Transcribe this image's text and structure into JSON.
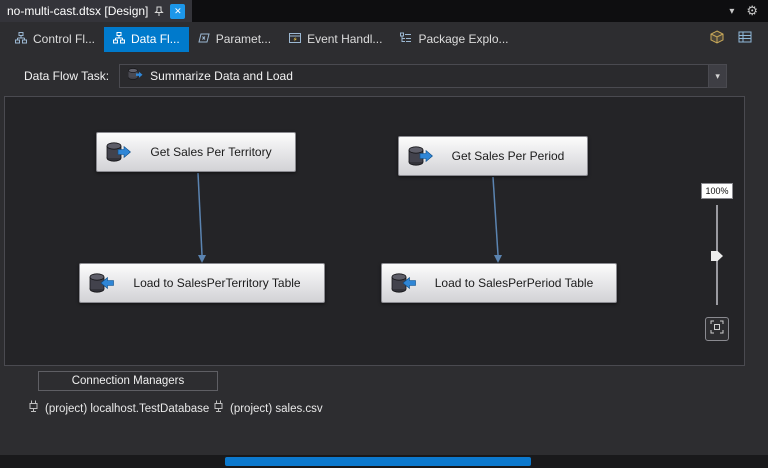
{
  "colors": {
    "accent": "#007acc",
    "connector": "#5b84b1",
    "scroll_thumb": "#0c79ce"
  },
  "glyphs": {
    "dropdown": "▾",
    "gear": "⚙",
    "close": "✕"
  },
  "title_bar": {
    "document_tab": "no-multi-cast.dtsx [Design]"
  },
  "design_tabs": {
    "active_index": 1,
    "items": [
      {
        "label": "Control Fl..."
      },
      {
        "label": "Data Fl..."
      },
      {
        "label": "Paramet..."
      },
      {
        "label": "Event Handl..."
      },
      {
        "label": "Package Explo..."
      }
    ]
  },
  "toolbar": {
    "task_label": "Data Flow Task:",
    "task_value": "Summarize Data and Load"
  },
  "canvas": {
    "zoom_level": "100%",
    "components": [
      {
        "label": "Get Sales Per Territory",
        "kind": "source"
      },
      {
        "label": "Get Sales Per Period",
        "kind": "source"
      },
      {
        "label": "Load to SalesPerTerritory Table",
        "kind": "destination"
      },
      {
        "label": "Load to SalesPerPeriod Table",
        "kind": "destination"
      }
    ],
    "connections": [
      {
        "from": "Get Sales Per Territory",
        "to": "Load to SalesPerTerritory Table"
      },
      {
        "from": "Get Sales Per Period",
        "to": "Load to SalesPerPeriod Table"
      }
    ]
  },
  "connection_managers": {
    "title": "Connection Managers",
    "items": [
      {
        "label": "(project) localhost.TestDatabase"
      },
      {
        "label": "(project) sales.csv"
      }
    ]
  }
}
